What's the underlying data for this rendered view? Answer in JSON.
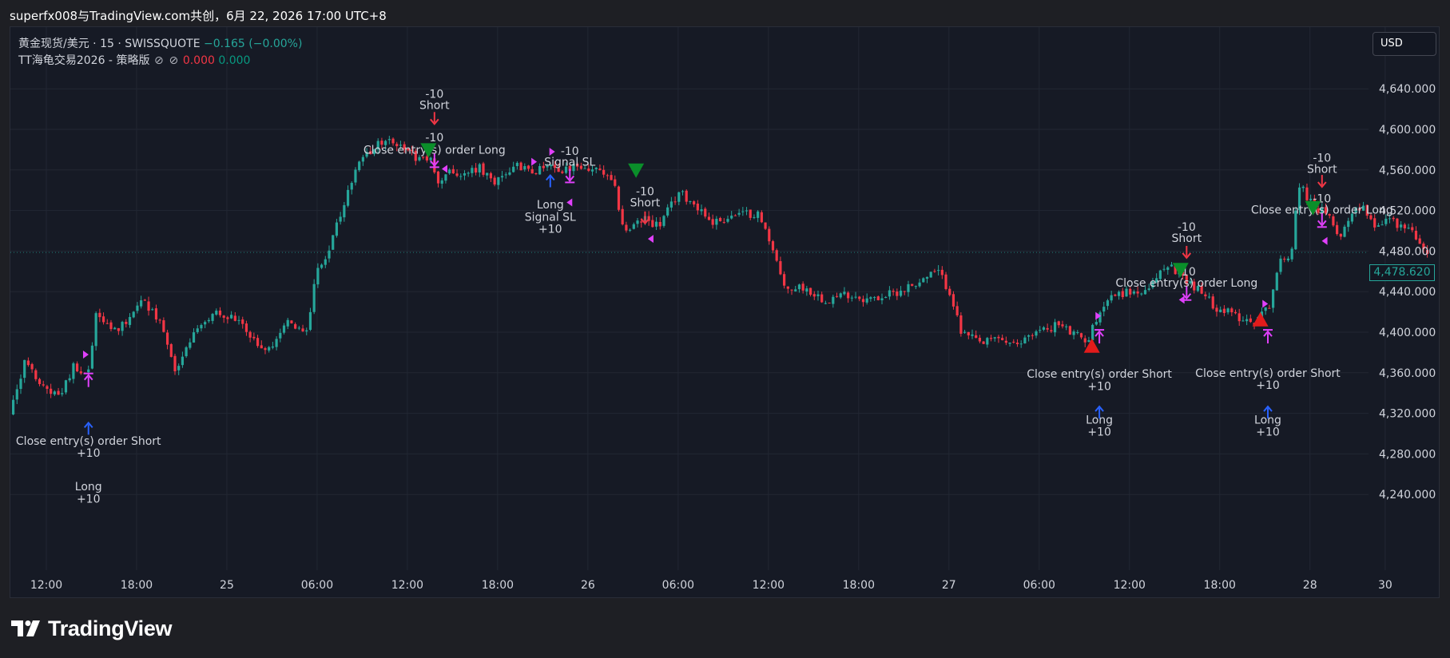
{
  "header": {
    "title": "superfx008与TradingView.com共创，6月 22, 2026 17:00 UTC+8"
  },
  "legend": {
    "symbol_line": "黄金现货/美元 · 15 · SWISSQUOTE",
    "change": "−0.165 (−0.00%)",
    "strategy_name": "TT海龟交易2026 - 策略版",
    "icon1": "⊘",
    "icon2": "⊘",
    "value_red": "0.000",
    "value_green": "0.000"
  },
  "currency_button": "USD",
  "last_price": "4,478.620",
  "brand": {
    "name": "TradingView"
  },
  "colors": {
    "up": "#26a69a",
    "down": "#f23645",
    "long_arrow": "#2962ff",
    "short_arrow": "#f23645",
    "close_marker": "#e040fb",
    "triangle_up": "#e21b1b",
    "triangle_down": "#0a8f2a"
  },
  "chart_data": {
    "type": "candlestick",
    "title": "",
    "xlabel": "",
    "ylabel": "",
    "y_ticks": [
      "4,640.000",
      "4,600.000",
      "4,560.000",
      "4,520.000",
      "4,480.000",
      "4,440.000",
      "4,400.000",
      "4,360.000",
      "4,320.000",
      "4,280.000",
      "4,240.000"
    ],
    "y_tick_values": [
      4640,
      4600,
      4560,
      4520,
      4480,
      4440,
      4400,
      4360,
      4320,
      4280,
      4240
    ],
    "x_ticks": [
      {
        "t": 0,
        "label": "12:00"
      },
      {
        "t": 6,
        "label": "18:00"
      },
      {
        "t": 12,
        "label": "25"
      },
      {
        "t": 18,
        "label": "06:00"
      },
      {
        "t": 24,
        "label": "12:00"
      },
      {
        "t": 30,
        "label": "18:00"
      },
      {
        "t": 36,
        "label": "26"
      },
      {
        "t": 42,
        "label": "06:00"
      },
      {
        "t": 48,
        "label": "12:00"
      },
      {
        "t": 54,
        "label": "18:00"
      },
      {
        "t": 60,
        "label": "27"
      },
      {
        "t": 66,
        "label": "06:00"
      },
      {
        "t": 72,
        "label": "12:00"
      },
      {
        "t": 78,
        "label": "18:00"
      },
      {
        "t": 84,
        "label": "28"
      },
      {
        "t": 89,
        "label": "30"
      }
    ],
    "y_range": [
      4222,
      4668
    ],
    "t_range": [
      -2.4,
      92.4
    ],
    "price_path": [
      [
        -2.2,
        4318
      ],
      [
        -1.2,
        4370
      ],
      [
        -0.2,
        4350
      ],
      [
        1.2,
        4335
      ],
      [
        2.0,
        4365
      ],
      [
        3.0,
        4362
      ],
      [
        3.6,
        4420
      ],
      [
        5.0,
        4400
      ],
      [
        6.5,
        4430
      ],
      [
        7.4,
        4420
      ],
      [
        8.2,
        4395
      ],
      [
        8.8,
        4358
      ],
      [
        10.0,
        4398
      ],
      [
        11.5,
        4423
      ],
      [
        13.0,
        4410
      ],
      [
        14.0,
        4392
      ],
      [
        15.0,
        4382
      ],
      [
        16.2,
        4412
      ],
      [
        17.0,
        4402
      ],
      [
        17.6,
        4400
      ],
      [
        18.2,
        4462
      ],
      [
        19.0,
        4478
      ],
      [
        20.0,
        4525
      ],
      [
        21.0,
        4568
      ],
      [
        22.0,
        4582
      ],
      [
        23.0,
        4595
      ],
      [
        24.0,
        4578
      ],
      [
        25.0,
        4572
      ],
      [
        25.8,
        4572
      ],
      [
        26.3,
        4545
      ],
      [
        27.0,
        4560
      ],
      [
        28.0,
        4555
      ],
      [
        29.0,
        4562
      ],
      [
        30.0,
        4548
      ],
      [
        31.5,
        4568
      ],
      [
        32.5,
        4555
      ],
      [
        33.5,
        4568
      ],
      [
        34.5,
        4558
      ],
      [
        35.5,
        4564
      ],
      [
        36.5,
        4560
      ],
      [
        37.2,
        4558
      ],
      [
        38.0,
        4543
      ],
      [
        38.7,
        4498
      ],
      [
        40.0,
        4512
      ],
      [
        41.0,
        4505
      ],
      [
        42.3,
        4538
      ],
      [
        43.5,
        4525
      ],
      [
        44.5,
        4508
      ],
      [
        46.0,
        4515
      ],
      [
        47.5,
        4518
      ],
      [
        48.6,
        4482
      ],
      [
        49.3,
        4442
      ],
      [
        50.5,
        4445
      ],
      [
        52.0,
        4432
      ],
      [
        53.5,
        4438
      ],
      [
        55.0,
        4432
      ],
      [
        56.5,
        4438
      ],
      [
        58.0,
        4448
      ],
      [
        59.5,
        4460
      ],
      [
        60.4,
        4438
      ],
      [
        61.0,
        4400
      ],
      [
        62.5,
        4388
      ],
      [
        63.5,
        4395
      ],
      [
        64.8,
        4385
      ],
      [
        65.5,
        4398
      ],
      [
        66.5,
        4402
      ],
      [
        67.5,
        4408
      ],
      [
        68.5,
        4398
      ],
      [
        69.5,
        4392
      ],
      [
        70.2,
        4420
      ],
      [
        71.0,
        4436
      ],
      [
        72.2,
        4440
      ],
      [
        73.5,
        4438
      ],
      [
        74.2,
        4460
      ],
      [
        75.0,
        4465
      ],
      [
        76.5,
        4446
      ],
      [
        78.0,
        4425
      ],
      [
        79.0,
        4418
      ],
      [
        80.5,
        4410
      ],
      [
        81.5,
        4425
      ],
      [
        82.2,
        4468
      ],
      [
        83.0,
        4478
      ],
      [
        83.5,
        4548
      ],
      [
        84.3,
        4528
      ],
      [
        85.5,
        4512
      ],
      [
        86.3,
        4495
      ],
      [
        87.2,
        4525
      ],
      [
        88.0,
        4520
      ],
      [
        88.6,
        4505
      ],
      [
        89.5,
        4512
      ],
      [
        90.3,
        4505
      ],
      [
        91.2,
        4497
      ],
      [
        91.8,
        4479
      ]
    ],
    "last_price": 4478.62
  },
  "markers": {
    "labels": [
      {
        "text": "-10",
        "t": 25.8,
        "y": 4631
      },
      {
        "text": "Short",
        "t": 25.8,
        "y": 4620
      },
      {
        "text": "-10",
        "t": 25.8,
        "y": 4588
      },
      {
        "text": "Close entry(s) order Long",
        "t": 25.8,
        "y": 4576
      },
      {
        "text": "-10",
        "t": 34.8,
        "y": 4575
      },
      {
        "text": "Signal SL",
        "t": 34.8,
        "y": 4564
      },
      {
        "text": "Long",
        "t": 33.5,
        "y": 4522
      },
      {
        "text": "Signal SL",
        "t": 33.5,
        "y": 4510
      },
      {
        "text": "+10",
        "t": 33.5,
        "y": 4498
      },
      {
        "text": "-10",
        "t": 39.8,
        "y": 4535
      },
      {
        "text": "Short",
        "t": 39.8,
        "y": 4524
      },
      {
        "text": "-10",
        "t": 75.8,
        "y": 4500
      },
      {
        "text": "Short",
        "t": 75.8,
        "y": 4489
      },
      {
        "text": "-10",
        "t": 75.8,
        "y": 4456
      },
      {
        "text": "Close entry(s) order Long",
        "t": 75.8,
        "y": 4445
      },
      {
        "text": "-10",
        "t": 84.8,
        "y": 4568
      },
      {
        "text": "Short",
        "t": 84.8,
        "y": 4557
      },
      {
        "text": "-10",
        "t": 84.8,
        "y": 4528
      },
      {
        "text": "Close entry(s) order Long",
        "t": 84.8,
        "y": 4517
      },
      {
        "text": "Close entry(s) order Short",
        "t": 70.0,
        "y": 4355
      },
      {
        "text": "+10",
        "t": 70.0,
        "y": 4343
      },
      {
        "text": "Long",
        "t": 70.0,
        "y": 4310
      },
      {
        "text": "+10",
        "t": 70.0,
        "y": 4298
      },
      {
        "text": "Close entry(s) order Short",
        "t": 81.2,
        "y": 4356
      },
      {
        "text": "+10",
        "t": 81.2,
        "y": 4344
      },
      {
        "text": "Long",
        "t": 81.2,
        "y": 4310
      },
      {
        "text": "+10",
        "t": 81.2,
        "y": 4298
      },
      {
        "text": "Close entry(s) order Short",
        "t": 2.8,
        "y": 4289
      },
      {
        "text": "+10",
        "t": 2.8,
        "y": 4277
      },
      {
        "text": "Long",
        "t": 2.8,
        "y": 4244
      },
      {
        "text": "+10",
        "t": 2.8,
        "y": 4232
      }
    ],
    "arrows": [
      {
        "dir": "down",
        "color": "short",
        "t": 25.8,
        "y": 4610
      },
      {
        "dir": "down",
        "color": "close",
        "t": 25.8,
        "y": 4569
      },
      {
        "dir": "up",
        "color": "long",
        "t": 33.5,
        "y": 4550
      },
      {
        "dir": "down",
        "color": "close",
        "t": 34.8,
        "y": 4554
      },
      {
        "dir": "down",
        "color": "short",
        "t": 39.8,
        "y": 4512
      },
      {
        "dir": "down",
        "color": "short",
        "t": 75.8,
        "y": 4478
      },
      {
        "dir": "down",
        "color": "close",
        "t": 75.8,
        "y": 4438
      },
      {
        "dir": "down",
        "color": "short",
        "t": 84.8,
        "y": 4548
      },
      {
        "dir": "down",
        "color": "close",
        "t": 84.8,
        "y": 4510
      },
      {
        "dir": "up",
        "color": "close",
        "t": 70.0,
        "y": 4396
      },
      {
        "dir": "up",
        "color": "long",
        "t": 70.0,
        "y": 4322
      },
      {
        "dir": "up",
        "color": "close",
        "t": 81.2,
        "y": 4396
      },
      {
        "dir": "up",
        "color": "long",
        "t": 81.2,
        "y": 4322
      },
      {
        "dir": "up",
        "color": "close",
        "t": 2.8,
        "y": 4353
      },
      {
        "dir": "up",
        "color": "long",
        "t": 2.8,
        "y": 4306
      }
    ],
    "triangles": [
      {
        "dir": "down",
        "t": 25.4,
        "y": 4580
      },
      {
        "dir": "down",
        "t": 39.2,
        "y": 4560
      },
      {
        "dir": "down",
        "t": 75.4,
        "y": 4462
      },
      {
        "dir": "down",
        "t": 84.2,
        "y": 4523
      },
      {
        "dir": "up",
        "t": 69.5,
        "y": 4386
      },
      {
        "dir": "up",
        "t": 80.7,
        "y": 4412
      }
    ],
    "small_marks": [
      {
        "side": "right",
        "t": 2.6,
        "y": 4378
      },
      {
        "side": "left",
        "t": 26.5,
        "y": 4561
      },
      {
        "side": "right",
        "t": 32.4,
        "y": 4568
      },
      {
        "side": "right",
        "t": 33.6,
        "y": 4578
      },
      {
        "side": "left",
        "t": 34.8,
        "y": 4528
      },
      {
        "side": "left",
        "t": 40.2,
        "y": 4492
      },
      {
        "side": "right",
        "t": 69.9,
        "y": 4416
      },
      {
        "side": "left",
        "t": 75.5,
        "y": 4432
      },
      {
        "side": "right",
        "t": 81.0,
        "y": 4428
      },
      {
        "side": "left",
        "t": 85.0,
        "y": 4490
      }
    ]
  }
}
